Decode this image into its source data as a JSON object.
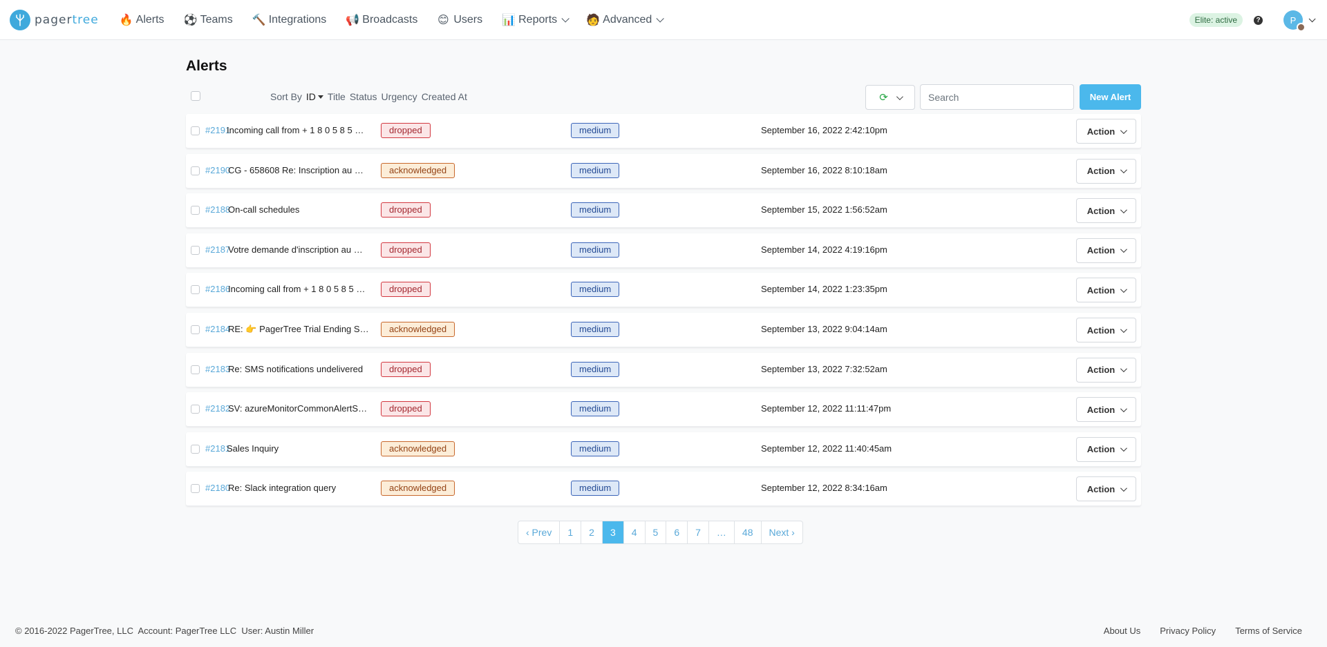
{
  "nav": {
    "brand_left": "pager",
    "brand_right": "tree",
    "items": [
      {
        "label": "Alerts",
        "icon": "🔥",
        "icon_name": "fire-icon"
      },
      {
        "label": "Teams",
        "icon": "⚽",
        "icon_name": "soccer-ball-icon"
      },
      {
        "label": "Integrations",
        "icon": "🔨",
        "icon_name": "hammer-icon"
      },
      {
        "label": "Broadcasts",
        "icon": "📢",
        "icon_name": "megaphone-icon"
      },
      {
        "label": "Users",
        "icon": "😊",
        "icon_name": "smiley-icon"
      },
      {
        "label": "Reports",
        "icon": "📊",
        "icon_name": "bar-chart-icon"
      },
      {
        "label": "Advanced",
        "icon": "🧑",
        "icon_name": "scientist-icon"
      }
    ],
    "plan_badge": "Elite: active",
    "help": "?",
    "avatar_initial": "P"
  },
  "page": {
    "title": "Alerts"
  },
  "toolbar": {
    "sort_by_label": "Sort By",
    "sort_options": [
      "ID",
      "Title",
      "Status",
      "Urgency",
      "Created At"
    ],
    "search_placeholder": "Search",
    "new_alert_label": "New Alert"
  },
  "alerts": [
    {
      "id": "#2191",
      "title": "Incoming call from + 1 8 0 5 8 5 …",
      "status": "dropped",
      "urgency": "medium",
      "created": "September 16, 2022 2:42:10pm",
      "action": "Action"
    },
    {
      "id": "#2190",
      "title": "CG - 658608 Re: Inscription au …",
      "status": "acknowledged",
      "urgency": "medium",
      "created": "September 16, 2022 8:10:18am",
      "action": "Action"
    },
    {
      "id": "#2188",
      "title": "On-call schedules",
      "status": "dropped",
      "urgency": "medium",
      "created": "September 15, 2022 1:56:52am",
      "action": "Action"
    },
    {
      "id": "#2187",
      "title": "Votre demande d'inscription au …",
      "status": "dropped",
      "urgency": "medium",
      "created": "September 14, 2022 4:19:16pm",
      "action": "Action"
    },
    {
      "id": "#2186",
      "title": "Incoming call from + 1 8 0 5 8 5 …",
      "status": "dropped",
      "urgency": "medium",
      "created": "September 14, 2022 1:23:35pm",
      "action": "Action"
    },
    {
      "id": "#2184",
      "title": "RE: 👉 PagerTree Trial Ending S…",
      "status": "acknowledged",
      "urgency": "medium",
      "created": "September 13, 2022 9:04:14am",
      "action": "Action"
    },
    {
      "id": "#2183",
      "title": "Re: SMS notifications undelivered",
      "status": "dropped",
      "urgency": "medium",
      "created": "September 13, 2022 7:32:52am",
      "action": "Action"
    },
    {
      "id": "#2182",
      "title": "SV: azureMonitorCommonAlertS…",
      "status": "dropped",
      "urgency": "medium",
      "created": "September 12, 2022 11:11:47pm",
      "action": "Action"
    },
    {
      "id": "#2181",
      "title": "Sales Inquiry",
      "status": "acknowledged",
      "urgency": "medium",
      "created": "September 12, 2022 11:40:45am",
      "action": "Action"
    },
    {
      "id": "#2180",
      "title": "Re: Slack integration query",
      "status": "acknowledged",
      "urgency": "medium",
      "created": "September 12, 2022 8:34:16am",
      "action": "Action"
    }
  ],
  "pagination": {
    "prev": "‹ Prev",
    "pages": [
      "1",
      "2",
      "3",
      "4",
      "5",
      "6",
      "7",
      "…",
      "48"
    ],
    "active": "3",
    "next": "Next ›"
  },
  "footer": {
    "copyright": "© 2016-2022 PagerTree, LLC",
    "account": "Account: PagerTree LLC",
    "user": "User: Austin Miller",
    "links": [
      "About Us",
      "Privacy Policy",
      "Terms of Service"
    ]
  },
  "colors": {
    "accent": "#4bb8ec",
    "dropped": "#d2363f",
    "acknowledged": "#c7672b",
    "urgency": "#3b64b8"
  }
}
